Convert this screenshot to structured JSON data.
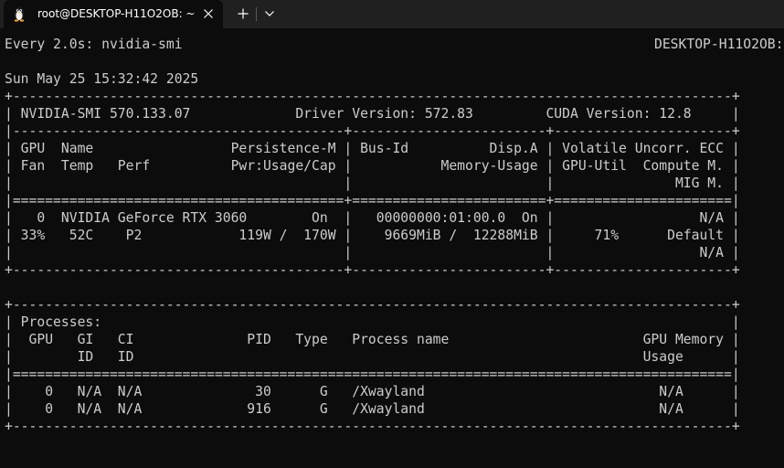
{
  "tab": {
    "title": "root@DESKTOP-H11O2OB: ~",
    "icon": "linux-penguin-icon"
  },
  "colors": {
    "terminal_bg": "#0c0c0c",
    "terminal_fg": "#cccccc",
    "tabstrip_bg": "#202020"
  },
  "terminal": {
    "watch_header": "Every 2.0s: nvidia-smi",
    "hostname": "DESKTOP-H11O2OB:",
    "lines": [
      "Sun May 25 15:32:42 2025",
      "+-----------------------------------------------------------------------------------------+",
      "| NVIDIA-SMI 570.133.07             Driver Version: 572.83         CUDA Version: 12.8     |",
      "|-----------------------------------------+------------------------+----------------------+",
      "| GPU  Name                 Persistence-M | Bus-Id          Disp.A | Volatile Uncorr. ECC |",
      "| Fan  Temp   Perf          Pwr:Usage/Cap |           Memory-Usage | GPU-Util  Compute M. |",
      "|                                         |                        |               MIG M. |",
      "|=========================================+========================+======================|",
      "|   0  NVIDIA GeForce RTX 3060        On  |   00000000:01:00.0  On |                  N/A |",
      "| 33%   52C    P2            119W /  170W |    9669MiB /  12288MiB |     71%      Default |",
      "|                                         |                        |                  N/A |",
      "+-----------------------------------------+------------------------+----------------------+",
      "",
      "+-----------------------------------------------------------------------------------------+",
      "| Processes:                                                                              |",
      "|  GPU   GI   CI              PID   Type   Process name                        GPU Memory |",
      "|        ID   ID                                                               Usage      |",
      "|=========================================================================================|",
      "|    0   N/A  N/A              30      G   /Xwayland                             N/A      |",
      "|    0   N/A  N/A             916      G   /Xwayland                             N/A      |",
      "+-----------------------------------------------------------------------------------------+"
    ]
  }
}
